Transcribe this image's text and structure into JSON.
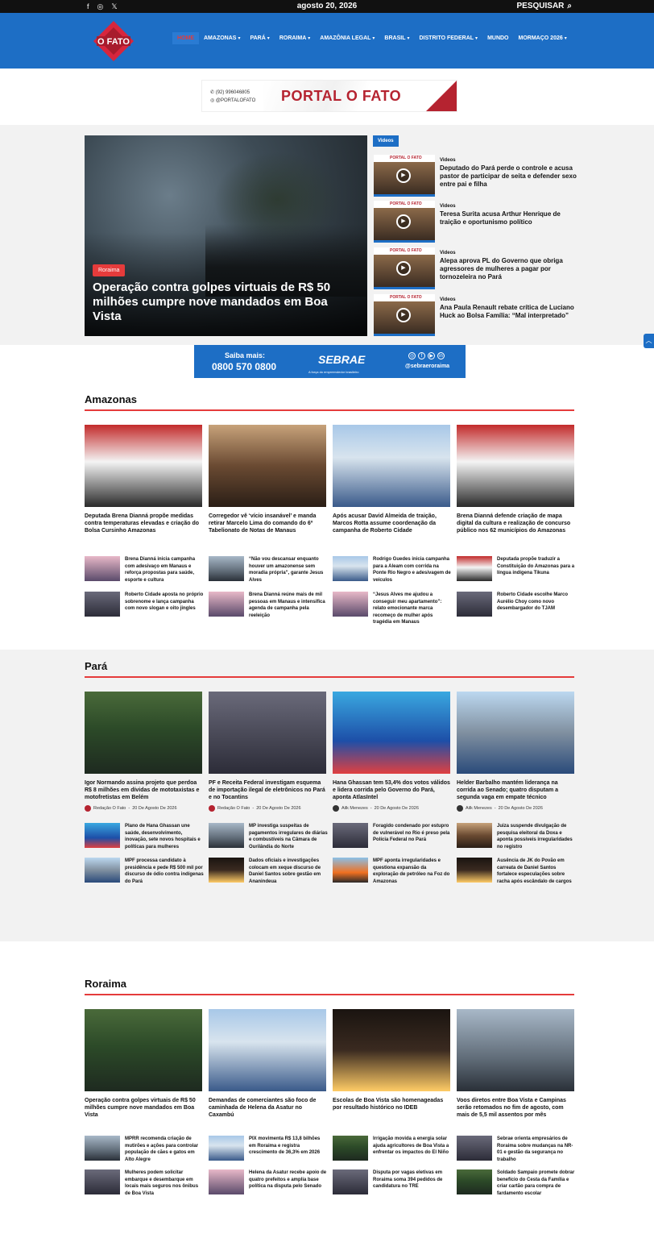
{
  "topbar": {
    "date": "agosto 20, 2026",
    "search_label": "PESQUISAR",
    "social": [
      "facebook-icon",
      "instagram-icon",
      "x-icon"
    ]
  },
  "header": {
    "logo_text": "O FATO",
    "nav": [
      {
        "label": "HOME",
        "chevron": false,
        "active": true
      },
      {
        "label": "AMAZONAS",
        "chevron": true
      },
      {
        "label": "PARÁ",
        "chevron": true
      },
      {
        "label": "RORAIMA",
        "chevron": true
      },
      {
        "label": "AMAZÔNIA LEGAL",
        "chevron": true
      },
      {
        "label": "BRASIL",
        "chevron": true
      },
      {
        "label": "DISTRITO FEDERAL",
        "chevron": true
      },
      {
        "label": "MUNDO",
        "chevron": false
      },
      {
        "label": "MORMAÇO 2026",
        "chevron": true
      }
    ]
  },
  "banner_top": {
    "phone": "(92) 996046805",
    "handle": "@PORTALOFATO",
    "brand": "PORTAL O FATO"
  },
  "hero": {
    "category": "Roraima",
    "title": "Operação contra golpes virtuais de R$ 50 milhões cumpre nove mandados em Boa Vista"
  },
  "videos": {
    "tag": "Videos",
    "thumb_brand": "PORTAL O FATO",
    "items": [
      {
        "category": "Videos",
        "title": "Deputado do Pará perde o controle e acusa pastor de participar de seita e defender sexo entre pai e filha"
      },
      {
        "category": "Videos",
        "title": "Teresa Surita acusa Arthur Henrique de traição e oportunismo político"
      },
      {
        "category": "Videos",
        "title": "Alepa aprova PL do Governo que obriga agressores de mulheres a pagar por tornozeleira no Pará"
      },
      {
        "category": "Videos",
        "title": "Ana Paula Renault rebate crítica de Luciano Huck ao Bolsa Família: “Mal interpretado”"
      }
    ]
  },
  "banner_sebrae": {
    "line1": "Saiba mais:",
    "line2": "0800 570 0800",
    "brand": "SEBRAE",
    "tagline": "A força do empreendedor brasileiro",
    "handle": "@sebraeroraima"
  },
  "amazonas": {
    "title": "Amazonas",
    "cards": [
      {
        "title": "Deputada Brena Dianná propõe medidas contra temperaturas elevadas e criação do Bolsa Cursinho Amazonas"
      },
      {
        "title": "Corregedor vê ‘vício insanável’ e manda retirar Marcelo Lima do comando do 6º Tabelionato de Notas de Manaus"
      },
      {
        "title": "Após acusar David Almeida de traição, Marcos Rotta assume coordenação da campanha de Roberto Cidade"
      },
      {
        "title": "Brena Dianná defende criação de mapa digital da cultura e realização de concurso público nos 62 municípios do Amazonas"
      }
    ],
    "minis": [
      {
        "title": "Brena Dianná inicia campanha com adesivaço em Manaus e reforça propostas para saúde, esporte e cultura"
      },
      {
        "title": "“Não vou descansar enquanto houver um amazonense sem moradia própria”, garante Jesus Alves"
      },
      {
        "title": "Rodrigo Guedes inicia campanha para a Aleam com corrida na Ponte Rio Negro e adesivagem de veículos"
      },
      {
        "title": "Deputada propõe traduzir a Constituição do Amazonas para a língua indígena Tikuna"
      },
      {
        "title": "Roberto Cidade aposta no próprio sobrenome e lança campanha com novo slogan e oito jingles"
      },
      {
        "title": "Brena Dianná reúne mais de mil pessoas em Manaus e intensifica agenda de campanha pela reeleição"
      },
      {
        "title": "“Jesus Alves me ajudou a conseguir meu apartamento”: relato emocionante marca recomeço de mulher após tragédia em Manaus"
      },
      {
        "title": "Roberto Cidade escolhe Marco Aurélio Choy como novo desembargador do TJAM"
      }
    ]
  },
  "para": {
    "title": "Pará",
    "cards": [
      {
        "title": "Igor Normando assina projeto que perdoa R$ 8 milhões em dívidas de mototaxistas e motofretistas em Belém",
        "author": "Redação O Fato",
        "date": "20 De Agosto De 2026"
      },
      {
        "title": "PF e Receita Federal investigam esquema de importação ilegal de eletrônicos no Pará e no Tocantins",
        "author": "Redação O Fato",
        "date": "20 De Agosto De 2026"
      },
      {
        "title": "Hana Ghassan tem 53,4% dos votos válidos e lidera corrida pelo Governo do Pará, aponta AtlasIntel",
        "author": "Ailk Menezes",
        "date": "20 De Agosto De 2026"
      },
      {
        "title": "Helder Barbalho mantém liderança na corrida ao Senado; quatro disputam a segunda vaga em empate técnico",
        "author": "Ailk Menezes",
        "date": "20 De Agosto De 2026"
      }
    ],
    "minis": [
      {
        "title": "Plano de Hana Ghassan une saúde, desenvolvimento, inovação, sete novos hospitais e políticas para mulheres"
      },
      {
        "title": "MP investiga suspeitas de pagamentos irregulares de diárias e combustíveis na Câmara de Ourilândia do Norte"
      },
      {
        "title": "Foragido condenado por estupro de vulnerável no Rio é preso pela Polícia Federal no Pará"
      },
      {
        "title": "Juiza suspende divulgação de pesquisa eleitoral da Doxa e aponta possíveis irregularidades no registro"
      },
      {
        "title": "MPF processa candidato à presidência e pede R$ 500 mil por discurso de ódio contra indígenas do Pará"
      },
      {
        "title": "Dados oficiais e investigações colocam em xeque discurso de Daniel Santos sobre gestão em Ananindeua"
      },
      {
        "title": "MPF aponta irregularidades e questiona expansão da exploração de petróleo na Foz do Amazonas"
      },
      {
        "title": "Ausência de JK do Povão em carreata de Daniel Santos fortalece especulações sobre racha após escândalo de cargos"
      }
    ]
  },
  "roraima": {
    "title": "Roraima",
    "cards": [
      {
        "title": "Operação contra golpes virtuais de R$ 50 milhões cumpre nove mandados em Boa Vista"
      },
      {
        "title": "Demandas de comerciantes são foco de caminhada de Helena da Asatur no Caxambú"
      },
      {
        "title": "Escolas de Boa Vista são homenageadas por resultado histórico no IDEB"
      },
      {
        "title": "Voos diretos entre Boa Vista e Campinas serão retomados no fim de agosto, com mais de 5,5 mil assentos por mês"
      }
    ],
    "minis": [
      {
        "title": "MPRR recomenda criação de mutirões e ações para controlar população de cães e gatos em Alto Alegre"
      },
      {
        "title": "PIX movimenta R$ 13,8 bilhões em Roraima e registra crescimento de 36,3% em 2026"
      },
      {
        "title": "Irrigação movida a energia solar ajuda agricultores de Boa Vista a enfrentar os impactos do El Niño"
      },
      {
        "title": "Sebrae orienta empresários de Roraima sobre mudanças na NR-01 e gestão da segurança no trabalho"
      },
      {
        "title": "Mulheres podem solicitar embarque e desembarque em locais mais seguros nos ônibus de Boa Vista"
      },
      {
        "title": "Helena da Asatur recebe apoio de quatro prefeitos e amplia base política na disputa pelo Senado"
      },
      {
        "title": "Disputa por vagas eletivas em Roraima soma 394 pedidos de candidatura no TRE"
      },
      {
        "title": "Soldado Sampaio promete dobrar benefício do Cesta da Família e criar cartão para compra de fardamento escolar"
      }
    ]
  }
}
